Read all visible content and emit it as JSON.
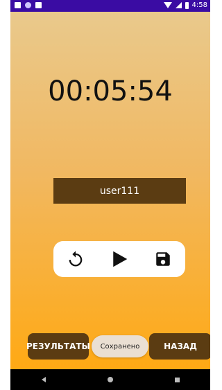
{
  "status_bar": {
    "time": "4:58",
    "icons_left": [
      "notification-a-icon",
      "circle-icon",
      "sd-card-icon"
    ],
    "icons_right": [
      "wifi-icon",
      "signal-icon",
      "battery-icon"
    ],
    "color": "#3a0ca3"
  },
  "timer": {
    "display": "00:05:54"
  },
  "user": {
    "name": "user111"
  },
  "controls": {
    "icons": [
      "restart-icon",
      "play-icon",
      "save-icon"
    ]
  },
  "buttons": {
    "results_label": "РЕЗУЛЬТАТЫ",
    "back_label": "НАЗАД"
  },
  "toast": {
    "message": "Сохранено"
  },
  "nav_bar": {
    "icons": [
      "back-icon",
      "home-icon",
      "recents-icon"
    ]
  },
  "colors": {
    "gradient_top": "#e9c98c",
    "gradient_bottom": "#ffa914",
    "button_bg": "#5b3c12"
  }
}
